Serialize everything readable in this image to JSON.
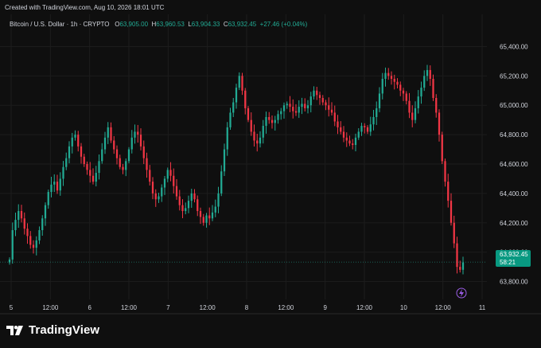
{
  "header": {
    "created_with": "Created with TradingView.com, Aug 10, 2026 18:01 UTC",
    "symbol": "Bitcoin / U.S. Dollar · 1h · CRYPTO",
    "o_label": "O",
    "o_value": "63,905.00",
    "h_label": "H",
    "h_value": "63,960.53",
    "l_label": "L",
    "l_value": "63,904.33",
    "c_label": "C",
    "c_value": "63,932.45",
    "change": "+27.46 (+0.04%)"
  },
  "price_tag": {
    "price": "63,932.45",
    "countdown": "58:21"
  },
  "footer": {
    "brand": "TradingView"
  },
  "colors": {
    "up": "#22ab94",
    "down": "#f23645",
    "background": "#0f0f0f",
    "grid": "#1c1c1c",
    "text": "#d1d4dc",
    "tag": "#089981"
  },
  "chart_data": {
    "type": "candlestick",
    "title": "Bitcoin / U.S. Dollar · 1h · CRYPTO",
    "ylim": [
      63700,
      65500
    ],
    "y_ticks": [
      "65,400.00",
      "65,200.00",
      "65,000.00",
      "64,800.00",
      "64,600.00",
      "64,400.00",
      "64,200.00",
      "64,000.00",
      "63,800.00"
    ],
    "y_tick_values": [
      65400,
      65200,
      65000,
      64800,
      64600,
      64400,
      64200,
      64000,
      63800
    ],
    "x_ticks": [
      "5",
      "12:00",
      "6",
      "12:00",
      "7",
      "12:00",
      "8",
      "12:00",
      "9",
      "12:00",
      "10",
      "12:00",
      "11"
    ],
    "last_price": 63932.45,
    "series": [
      {
        "name": "BTCUSD",
        "closes": [
          63950,
          64150,
          64220,
          64280,
          64230,
          64160,
          64110,
          64050,
          64030,
          64080,
          64150,
          64230,
          64320,
          64410,
          64460,
          64480,
          64420,
          64500,
          64580,
          64640,
          64720,
          64780,
          64800,
          64720,
          64650,
          64600,
          64560,
          64520,
          64480,
          64540,
          64620,
          64700,
          64780,
          64850,
          64760,
          64700,
          64640,
          64580,
          64560,
          64620,
          64700,
          64780,
          64820,
          64800,
          64720,
          64640,
          64560,
          64480,
          64400,
          64360,
          64380,
          64440,
          64500,
          64560,
          64520,
          64450,
          64380,
          64320,
          64280,
          64300,
          64350,
          64400,
          64360,
          64280,
          64240,
          64200,
          64250,
          64230,
          64270,
          64310,
          64400,
          64550,
          64700,
          64850,
          64950,
          65020,
          65120,
          65200,
          65100,
          64980,
          64900,
          64820,
          64760,
          64740,
          64780,
          64860,
          64920,
          64900,
          64880,
          64900,
          64940,
          64960,
          65000,
          65010,
          64990,
          64960,
          64950,
          64990,
          65010,
          64980,
          65000,
          65060,
          65100,
          65070,
          65050,
          65020,
          65000,
          64970,
          64950,
          64890,
          64850,
          64820,
          64780,
          64760,
          64740,
          64730,
          64780,
          64820,
          64860,
          64850,
          64820,
          64870,
          64920,
          64980,
          65080,
          65180,
          65220,
          65200,
          65180,
          65160,
          65140,
          65100,
          65080,
          65030,
          64950,
          64900,
          64980,
          65060,
          65120,
          65200,
          65240,
          65180,
          65050,
          64950,
          64800,
          64620,
          64480,
          64350,
          64200,
          64060,
          63900,
          63880,
          63930
        ]
      }
    ]
  }
}
